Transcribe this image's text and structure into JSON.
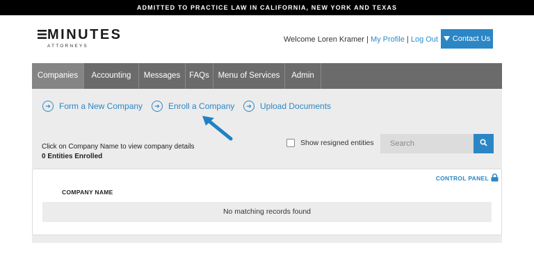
{
  "banner": {
    "text": "ADMITTED TO PRACTICE LAW IN CALIFORNIA, NEW YORK AND TEXAS"
  },
  "logo": {
    "name": "MINUTES",
    "subtitle": "ATTORNEYS"
  },
  "header": {
    "welcome": "Welcome Loren Kramer",
    "separator1": "|",
    "my_profile": "My Profile",
    "separator2": "|",
    "log_out": "Log Out",
    "contact_label": "Contact Us"
  },
  "nav": {
    "items": [
      {
        "label": "Companies",
        "active": true
      },
      {
        "label": "Accounting",
        "active": false
      },
      {
        "label": "Messages",
        "active": false
      },
      {
        "label": "FAQs",
        "active": false
      },
      {
        "label": "Menu of Services",
        "active": false
      },
      {
        "label": "Admin",
        "active": false
      }
    ]
  },
  "actions": [
    {
      "label": "Form a New Company",
      "icon": "arrow-right-circle-icon"
    },
    {
      "label": "Enroll a Company",
      "icon": "arrow-right-circle-icon"
    },
    {
      "label": "Upload Documents",
      "icon": "arrow-right-circle-icon"
    }
  ],
  "list": {
    "hint": "Click on Company Name to view company details",
    "count": "0 Entities Enrolled",
    "show_resigned_label": "Show resigned entities",
    "show_resigned_checked": false,
    "search_placeholder": "Search",
    "control_panel": "CONTROL PANEL",
    "column_header": "COMPANY NAME",
    "empty_message": "No matching records found"
  },
  "colors": {
    "accent": "#2b86c5",
    "nav_bg": "#6b6b6b",
    "nav_active": "#858585",
    "banner_bg": "#000000"
  }
}
